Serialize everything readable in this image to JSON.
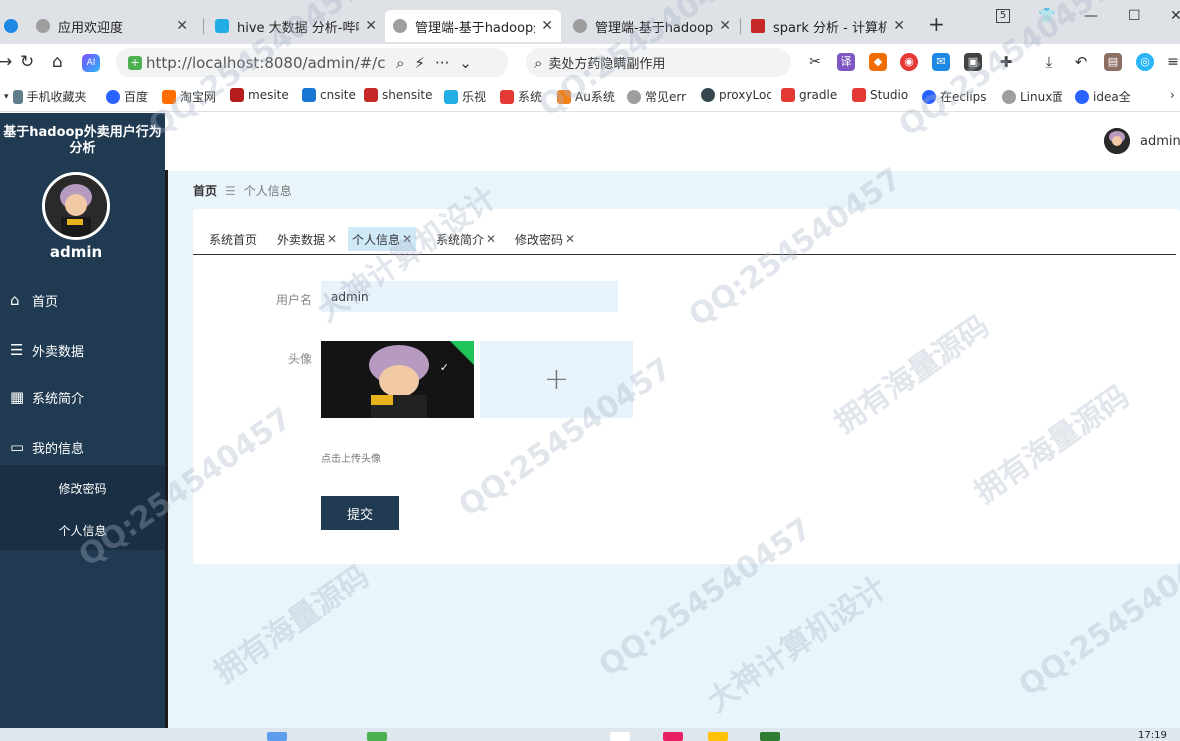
{
  "browser": {
    "tabs": [
      {
        "title": "应用欢迎度",
        "active": false
      },
      {
        "title": "hive 大数据 分析-哔哩",
        "active": false
      },
      {
        "title": "管理端-基于hadoop外",
        "active": true
      },
      {
        "title": "管理端-基于hadoop外",
        "active": false
      },
      {
        "title": "spark 分析 - 计算机毕",
        "active": false
      }
    ],
    "tab_count_badge": "5",
    "url": "http://localhost:8080/admin/#/center",
    "search_text": "卖处方药隐瞒副作用",
    "bookmarks": [
      "手机收藏夹",
      "百度",
      "淘宝网",
      "mesite",
      "cnsite",
      "shensite",
      "乐视",
      "系统",
      "Au系统",
      "常见err",
      "proxyLoc",
      "gradle",
      "Studio",
      "在eclipse",
      "Linux面",
      "idea全"
    ]
  },
  "app": {
    "system_title": "基于hadoop外卖用户行为分析",
    "sidebar_username": "admin",
    "menu": [
      {
        "label": "首页",
        "icon": "home-icon"
      },
      {
        "label": "外卖数据",
        "icon": "list-icon"
      },
      {
        "label": "系统简介",
        "icon": "grid-icon"
      },
      {
        "label": "我的信息",
        "icon": "card-icon"
      }
    ],
    "submenu": [
      "修改密码",
      "个人信息"
    ],
    "top_username": "admin"
  },
  "breadcrumb": {
    "home": "首页",
    "separator": "☰",
    "current": "个人信息"
  },
  "page_tabs": [
    {
      "label": "系统首页",
      "closable": false,
      "active": false
    },
    {
      "label": "外卖数据",
      "closable": true,
      "active": false
    },
    {
      "label": "个人信息",
      "closable": true,
      "active": true
    },
    {
      "label": "系统简介",
      "closable": true,
      "active": false
    },
    {
      "label": "修改密码",
      "closable": true,
      "active": false
    }
  ],
  "form": {
    "username_label": "用户名",
    "username_value": "admin",
    "avatar_label": "头像",
    "upload_tip": "点击上传头像",
    "submit_label": "提交"
  },
  "taskbar": {
    "time": "17:19"
  },
  "watermark": [
    "QQ:254540457",
    "大神计算机设计",
    "拥有海量源码"
  ],
  "colors": {
    "sidebar": "#1f3a51",
    "main_bg": "#eaf4fb",
    "active_tab": "#cfe9f7",
    "upload_ok": "#21c45b"
  }
}
